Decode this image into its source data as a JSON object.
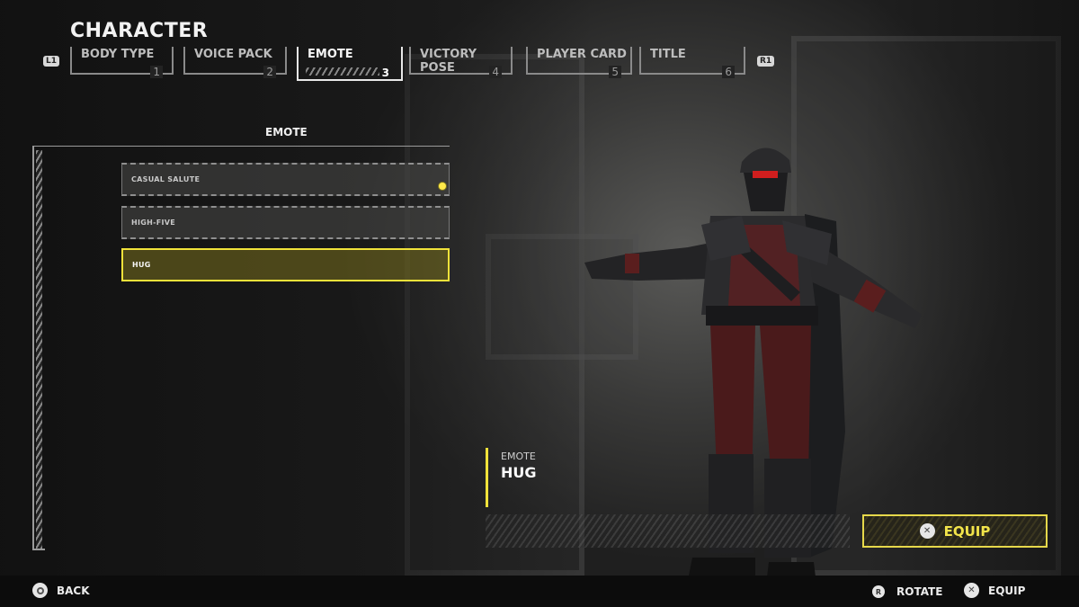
{
  "header": {
    "title": "CHARACTER",
    "left_bumper": "L1",
    "right_bumper": "R1"
  },
  "tabs": [
    {
      "label": "BODY TYPE",
      "number": "1",
      "active": false
    },
    {
      "label": "VOICE PACK",
      "number": "2",
      "active": false
    },
    {
      "label": "EMOTE",
      "number": "3",
      "active": true
    },
    {
      "label": "VICTORY POSE",
      "number": "4",
      "active": false
    },
    {
      "label": "PLAYER CARD",
      "number": "5",
      "active": false
    },
    {
      "label": "TITLE",
      "number": "6",
      "active": false
    }
  ],
  "list": {
    "heading": "EMOTE",
    "items": [
      {
        "label": "CASUAL SALUTE",
        "equipped": true,
        "selected": false
      },
      {
        "label": "HIGH-FIVE",
        "equipped": false,
        "selected": false
      },
      {
        "label": "HUG",
        "equipped": false,
        "selected": true
      }
    ]
  },
  "detail": {
    "category": "EMOTE",
    "name": "HUG"
  },
  "equip_button": {
    "label": "EQUIP",
    "icon": "cross-button-icon",
    "accent": "#f0e23a"
  },
  "footer": {
    "back": {
      "label": "BACK",
      "icon": "circle-button-icon"
    },
    "rotate": {
      "label": "ROTATE",
      "icon": "right-stick-icon",
      "stick": "R"
    },
    "equip": {
      "label": "EQUIP",
      "icon": "cross-button-icon"
    }
  }
}
